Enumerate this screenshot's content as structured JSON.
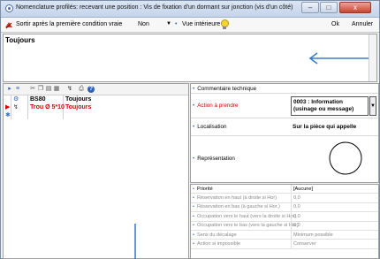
{
  "window": {
    "title": "Nomenclature profilés: recevant une position : Vis de fixation d'un dormant sur jonction (vis d'un côté)",
    "minimize": "–",
    "maximize": "□",
    "close": "x"
  },
  "toolbar": {
    "sort_label": "Sortir après la première condition vraie",
    "sort_value": "Non",
    "view_label": "Vue intérieure",
    "ok_label": "Ok",
    "cancel_label": "Annuler"
  },
  "condition": {
    "text": "Toujours"
  },
  "grid": {
    "rows": [
      {
        "code": "BS80",
        "condition": "Toujours",
        "selected": false,
        "color": "#000000"
      },
      {
        "code": "Trou Ø 5*10",
        "condition": "Toujours",
        "selected": true,
        "color": "#d00000"
      }
    ]
  },
  "properties": {
    "commentaire_label": "Commentaire technique",
    "action_label": "Action à prendre",
    "action_value_line1": "0003 : Information",
    "action_value_line2": "(usinage ou message)",
    "localisation_label": "Localisation",
    "localisation_value": "Sur la pièce qui appelle",
    "representation_label": "Représentation"
  },
  "details": {
    "rows": [
      {
        "label": "Priorité",
        "value": "[Aucune]",
        "active": true
      },
      {
        "label": "Réservation en haut (à droite si Hor)",
        "value": "0,0",
        "active": false
      },
      {
        "label": "Réservation en bas (à gauche si Hor.)",
        "value": "0,0",
        "active": false
      },
      {
        "label": "Occupation vers le haut (vers la droite si Hor)",
        "value": "0,0",
        "active": false
      },
      {
        "label": "Occupation vers le bas (vers la gauche si Hor)",
        "value": "0,0",
        "active": false
      },
      {
        "label": "Sens du décalage",
        "value": "Minimum possible",
        "active": false
      },
      {
        "label": "Action si impossible",
        "value": "Conserver",
        "active": false
      }
    ]
  },
  "colors": {
    "accent_blue": "#3c6fbf",
    "error_red": "#d00000",
    "annotation_arrow": "#3a7ec8"
  }
}
